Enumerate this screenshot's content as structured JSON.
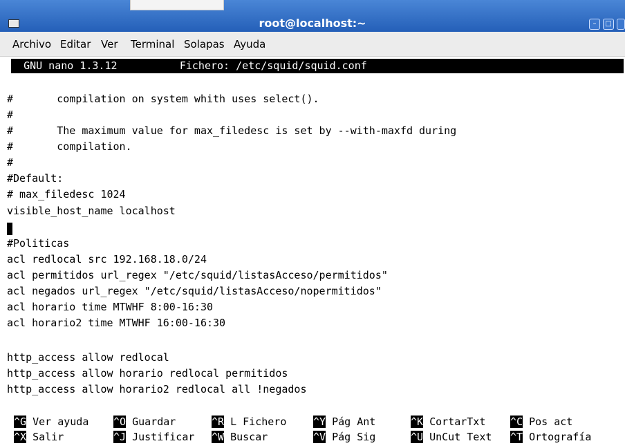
{
  "window": {
    "title": "root@localhost:~",
    "minimize_icon": "minimize-icon",
    "maximize_icon": "maximize-icon"
  },
  "menu": [
    "Archivo",
    "Editar",
    "Ver",
    "Terminal",
    "Solapas",
    "Ayuda"
  ],
  "nano": {
    "version": "GNU nano 1.3.12",
    "file_label": "Fichero: /etc/squid/squid.conf"
  },
  "lines": [
    "#       compilation on system whith uses select().",
    "#",
    "#       The maximum value for max_filedesc is set by --with-maxfd during",
    "#       compilation.",
    "#",
    "#Default:",
    "# max_filedesc 1024",
    "visible_host_name localhost",
    "",
    "#Politicas",
    "acl redlocal src 192.168.18.0/24",
    "acl permitidos url_regex \"/etc/squid/listasAcceso/permitidos\"",
    "acl negados url_regex \"/etc/squid/listasAcceso/nopermitidos\"",
    "acl horario time MTWHF 8:00-16:30",
    "acl horario2 time MTWHF 16:00-16:30",
    "",
    "http_access allow redlocal",
    "http_access allow horario redlocal permitidos",
    "http_access allow horario2 redlocal all !negados"
  ],
  "shortcuts_row1": [
    {
      "key": "^G",
      "label": "Ver ayuda"
    },
    {
      "key": "^O",
      "label": "Guardar"
    },
    {
      "key": "^R",
      "label": "L Fichero"
    },
    {
      "key": "^Y",
      "label": "Pág Ant"
    },
    {
      "key": "^K",
      "label": "CortarTxt"
    },
    {
      "key": "^C",
      "label": "Pos act"
    }
  ],
  "shortcuts_row2": [
    {
      "key": "^X",
      "label": "Salir"
    },
    {
      "key": "^J",
      "label": "Justificar"
    },
    {
      "key": "^W",
      "label": "Buscar"
    },
    {
      "key": "^V",
      "label": "Pág Sig"
    },
    {
      "key": "^U",
      "label": "UnCut Text"
    },
    {
      "key": "^T",
      "label": "Ortografía"
    }
  ]
}
